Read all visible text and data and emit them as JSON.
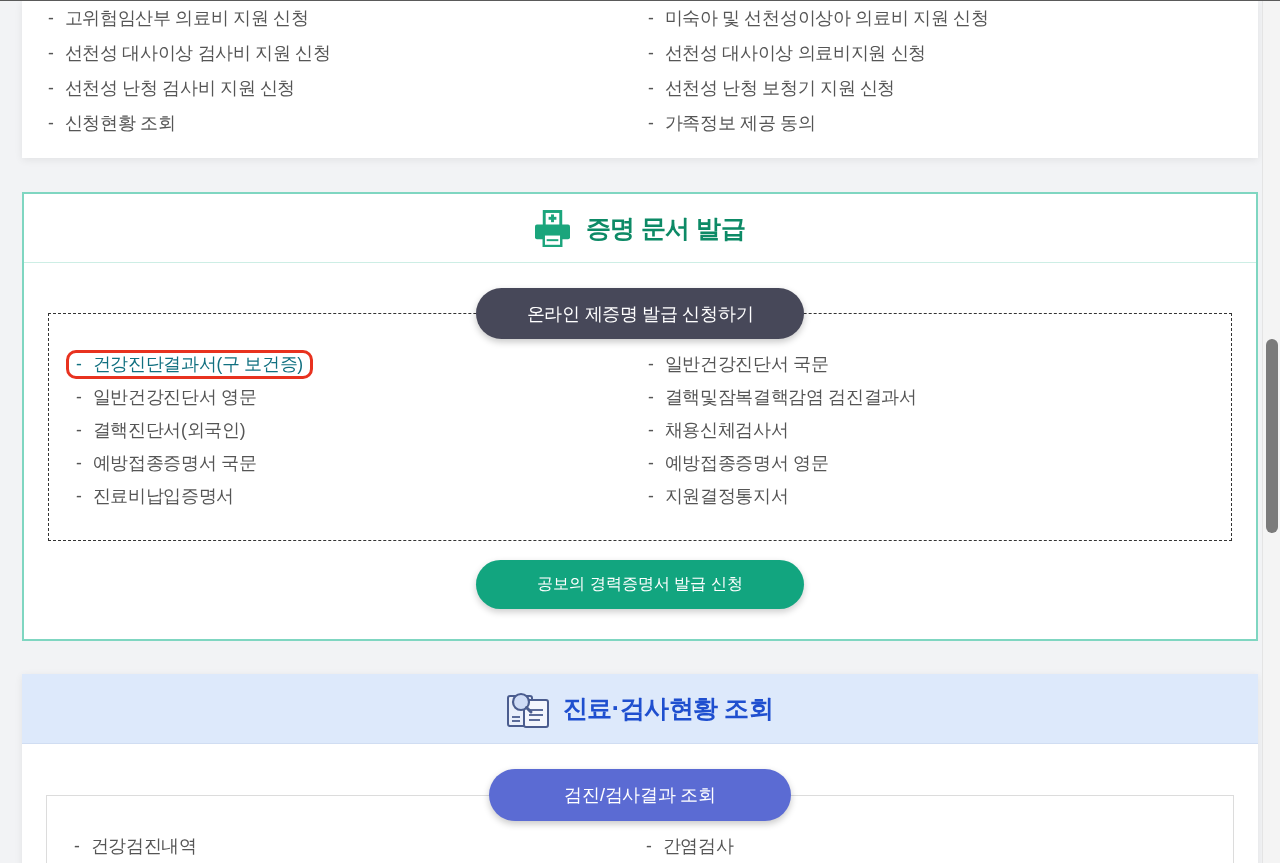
{
  "top_list": {
    "items": [
      {
        "marker": "-",
        "text": "고위험임산부 의료비 지원 신청"
      },
      {
        "marker": "-",
        "text": "미숙아 및 선천성이상아 의료비 지원 신청"
      },
      {
        "marker": "-",
        "text": "선천성 대사이상 검사비 지원 신청"
      },
      {
        "marker": "-",
        "text": "선천성 대사이상 의료비지원 신청"
      },
      {
        "marker": "-",
        "text": "선천성 난청 검사비 지원 신청"
      },
      {
        "marker": "-",
        "text": "선천성 난청 보청기 지원 신청"
      },
      {
        "marker": "-",
        "text": "신청현황 조회"
      },
      {
        "marker": "-",
        "text": "가족정보 제공 동의"
      }
    ]
  },
  "sections": [
    {
      "kind": "certificate",
      "title": "증명 문서 발급",
      "group_button": "온라인 제증명 발급 신청하기",
      "items": [
        {
          "marker": "-",
          "text": "건강진단결과서(구 보건증)",
          "highlighted": true
        },
        {
          "marker": "-",
          "text": "일반건강진단서 국문",
          "highlighted": false
        },
        {
          "marker": "-",
          "text": "일반건강진단서 영문",
          "highlighted": false
        },
        {
          "marker": "-",
          "text": "결핵및잠복결핵감염 검진결과서",
          "highlighted": false
        },
        {
          "marker": "-",
          "text": "결핵진단서(외국인)",
          "highlighted": false
        },
        {
          "marker": "-",
          "text": "채용신체검사서",
          "highlighted": false
        },
        {
          "marker": "-",
          "text": "예방접종증명서 국문",
          "highlighted": false
        },
        {
          "marker": "-",
          "text": "예방접종증명서 영문",
          "highlighted": false
        },
        {
          "marker": "-",
          "text": "진료비납입증명서",
          "highlighted": false
        },
        {
          "marker": "-",
          "text": "지원결정통지서",
          "highlighted": false
        }
      ],
      "footer_button": "공보의 경력증명서 발급 신청"
    },
    {
      "kind": "inquiry",
      "title": "진료·검사현황 조회",
      "group_button": "검진/검사결과 조회",
      "items": [
        {
          "marker": "-",
          "text": "건강검진내역"
        },
        {
          "marker": "-",
          "text": "간염검사"
        }
      ]
    }
  ]
}
